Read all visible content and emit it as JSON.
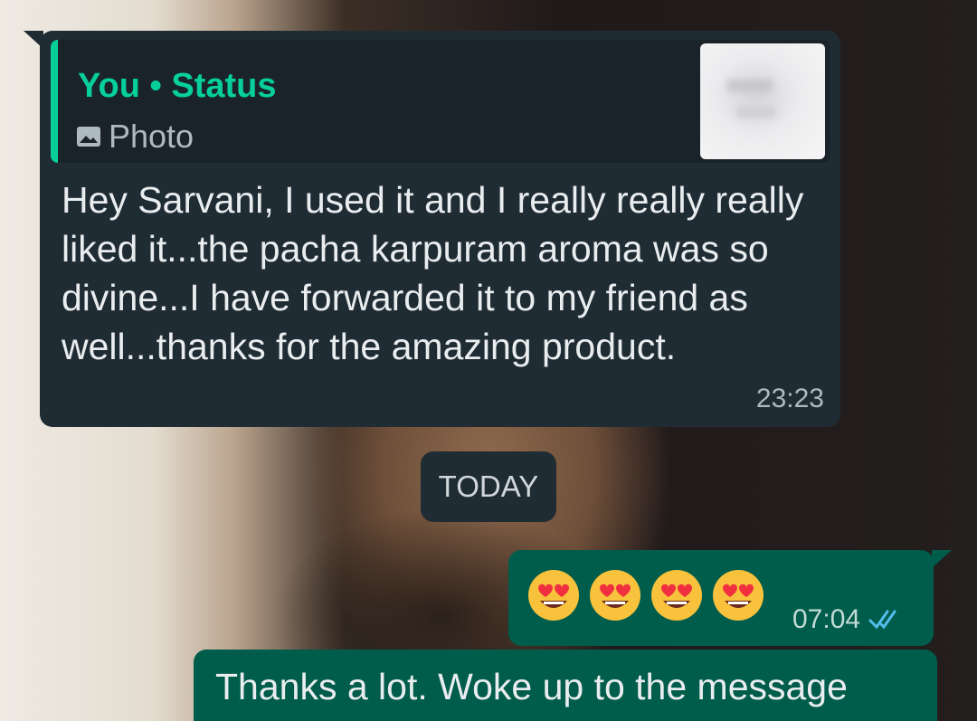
{
  "incoming_message": {
    "quote": {
      "author": "You",
      "separator": "•",
      "context": "Status",
      "attachment_icon": "photo-icon",
      "attachment_label": "Photo"
    },
    "text": "Hey Sarvani, I used it and I really really really liked it...the pacha karpuram aroma was so divine...I have forwarded it to my friend as well...thanks for the amazing product.",
    "time": "23:23"
  },
  "date_separator": "TODAY",
  "outgoing_message_1": {
    "emoji": [
      "😍",
      "😍",
      "😍",
      "😍"
    ],
    "emoji_name": "smiling-face-with-heart-eyes",
    "time": "07:04",
    "status_icon": "double-check-read-icon"
  },
  "outgoing_message_2": {
    "text": "Thanks a lot. Woke up to the message"
  },
  "colors": {
    "incoming_bubble": "#202c33",
    "outgoing_bubble": "#005c4b",
    "accent": "#06cf9c",
    "read_ticks": "#53bdeb"
  }
}
